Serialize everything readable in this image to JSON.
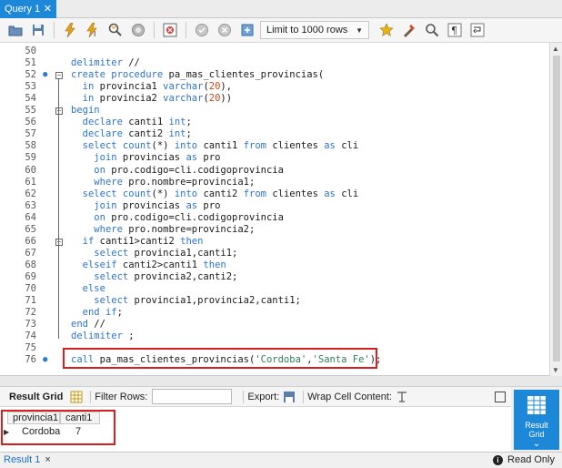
{
  "query_tab": {
    "label": "Query 1",
    "close": "✕"
  },
  "toolbar": {
    "limit_label": "Limit to 1000 rows"
  },
  "editor": {
    "lines": [
      {
        "n": "50",
        "code": ""
      },
      {
        "n": "51",
        "code": "delimiter //"
      },
      {
        "n": "52",
        "code": "create procedure pa_mas_clientes_provincias("
      },
      {
        "n": "53",
        "code": "  in provincia1 varchar(20),"
      },
      {
        "n": "54",
        "code": "  in provincia2 varchar(20))"
      },
      {
        "n": "55",
        "code": "begin"
      },
      {
        "n": "56",
        "code": "  declare canti1 int;"
      },
      {
        "n": "57",
        "code": "  declare canti2 int;"
      },
      {
        "n": "58",
        "code": "  select count(*) into canti1 from clientes as cli"
      },
      {
        "n": "59",
        "code": "    join provincias as pro"
      },
      {
        "n": "60",
        "code": "    on pro.codigo=cli.codigoprovincia"
      },
      {
        "n": "61",
        "code": "    where pro.nombre=provincia1;"
      },
      {
        "n": "62",
        "code": "  select count(*) into canti2 from clientes as cli"
      },
      {
        "n": "63",
        "code": "    join provincias as pro"
      },
      {
        "n": "64",
        "code": "    on pro.codigo=cli.codigoprovincia"
      },
      {
        "n": "65",
        "code": "    where pro.nombre=provincia2;"
      },
      {
        "n": "66",
        "code": "  if canti1>canti2 then"
      },
      {
        "n": "67",
        "code": "    select provincia1,canti1;"
      },
      {
        "n": "68",
        "code": "  elseif canti2>canti1 then"
      },
      {
        "n": "69",
        "code": "    select provincia2,canti2;"
      },
      {
        "n": "70",
        "code": "  else"
      },
      {
        "n": "71",
        "code": "    select provincia1,provincia2,canti1;"
      },
      {
        "n": "72",
        "code": "  end if;"
      },
      {
        "n": "73",
        "code": "end //"
      },
      {
        "n": "74",
        "code": "delimiter ;"
      },
      {
        "n": "75",
        "code": ""
      },
      {
        "n": "76",
        "code": "call pa_mas_clientes_provincias('Cordoba','Santa Fe');"
      }
    ]
  },
  "result_toolbar": {
    "result_grid": "Result Grid",
    "filter_rows": "Filter Rows:",
    "export": "Export:",
    "wrap_cell": "Wrap Cell Content:"
  },
  "result_grid": {
    "columns": [
      "provincia1",
      "canti1"
    ],
    "rows": [
      [
        "Cordoba",
        "7"
      ]
    ]
  },
  "side_panel": {
    "button_label_1": "Result",
    "button_label_2": "Grid"
  },
  "status": {
    "result_tab": "Result 1",
    "read_only": "Read Only"
  },
  "colors": {
    "accent": "#1e88d8",
    "highlight": "#d62020",
    "keyword": "#2d74c8",
    "string": "#2e7d5b",
    "number": "#c14b18"
  }
}
